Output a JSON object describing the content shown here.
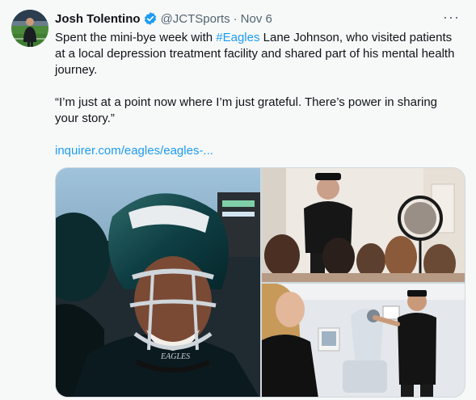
{
  "tweet": {
    "author_name": "Josh Tolentino",
    "handle": "@JCTSports",
    "separator": "·",
    "date": "Nov 6",
    "more_label": "···",
    "text_part1": "Spent the mini-bye week with ",
    "hashtag": "#Eagles",
    "text_part2": " Lane Johnson, who visited patients at a local depression treatment facility and shared part of his mental health journey.",
    "quote": "“I’m just at a point now where I’m just grateful. There’s power in sharing your story.”",
    "link_text": "inquirer.com/eagles/eagles-..."
  },
  "media": {
    "jersey_wordmark": "EAGLES"
  },
  "colors": {
    "link": "#1d9bf0",
    "verified": "#1d9bf0",
    "muted": "#536471",
    "background": "#f7f9f9"
  },
  "icons": {
    "verified": "verified-badge-icon",
    "more": "more-horizontal-icon"
  }
}
